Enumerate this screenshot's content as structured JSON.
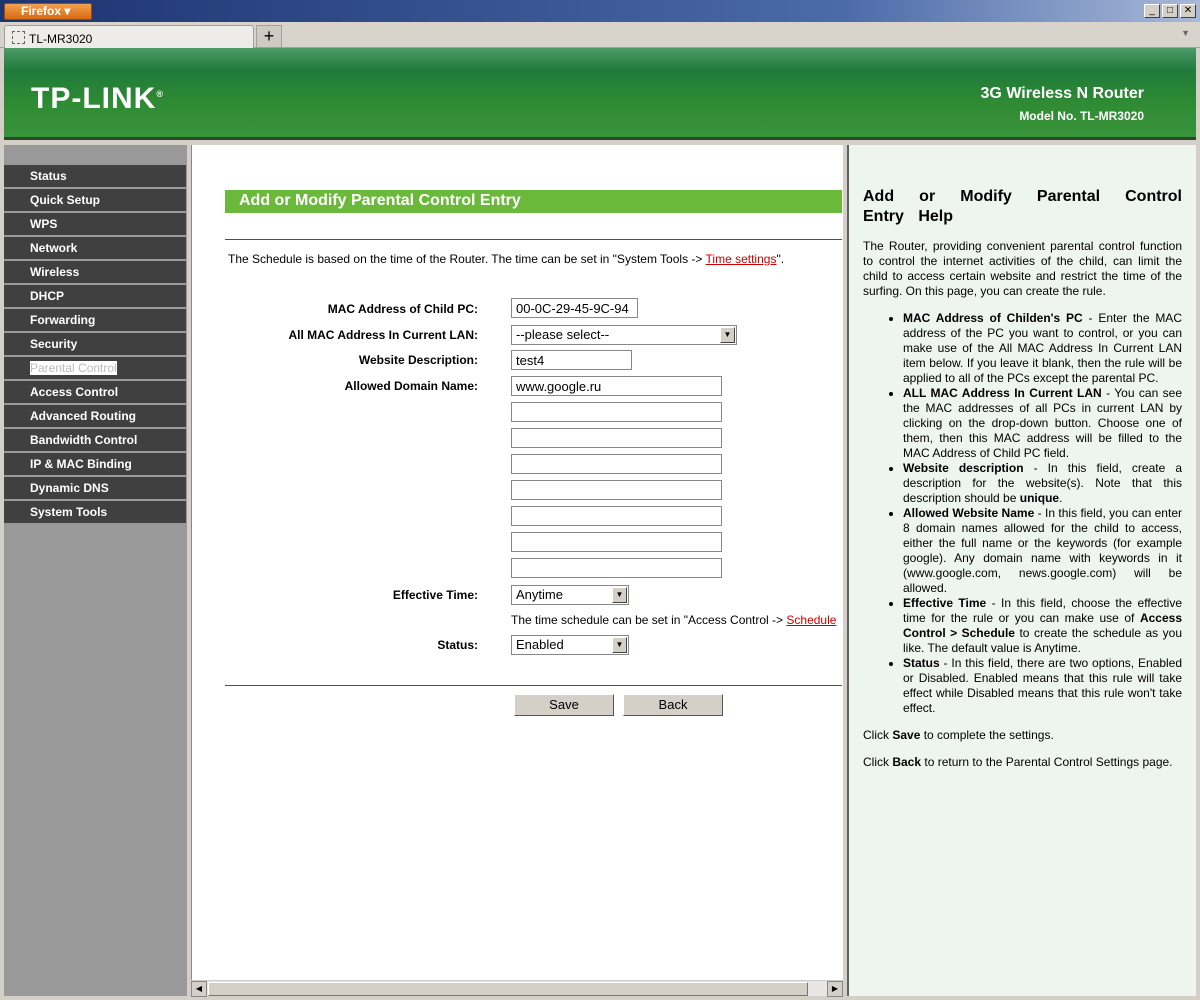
{
  "browser": {
    "menu_label": "Firefox",
    "tab_title": "TL-MR3020",
    "new_tab": "+",
    "window_controls": [
      "_",
      "□",
      "✕"
    ]
  },
  "banner": {
    "logo": "TP-LINK",
    "product": "3G Wireless N Router",
    "model": "Model No. TL-MR3020",
    "brand_color": "#2e8a34"
  },
  "sidebar": {
    "active": "Parental Control",
    "items": [
      "Status",
      "Quick Setup",
      "WPS",
      "Network",
      "Wireless",
      "DHCP",
      "Forwarding",
      "Security",
      "Parental Control",
      "Access Control",
      "Advanced Routing",
      "Bandwidth Control",
      "IP & MAC Binding",
      "Dynamic DNS",
      "System Tools"
    ]
  },
  "main": {
    "title": "Add or Modify Parental Control Entry",
    "note_prefix": "The Schedule is based on the time of the Router. The time can be set in \"System Tools -> ",
    "note_link": "Time settings",
    "note_suffix": "\".",
    "labels": {
      "mac": "MAC Address of Child PC:",
      "all_mac": "All MAC Address In Current LAN:",
      "desc": "Website Description:",
      "domain": "Allowed Domain Name:",
      "time": "Effective Time:",
      "status": "Status:"
    },
    "mac_value": "00-0C-29-45-9C-94",
    "all_mac_selected": "--please select--",
    "desc_value": "test4",
    "domains": [
      "www.google.ru",
      "",
      "",
      "",
      "",
      "",
      "",
      ""
    ],
    "time_selected": "Anytime",
    "schedule_note": "The time schedule can be set in \"Access Control -> ",
    "schedule_link": "Schedule",
    "status_selected": "Enabled",
    "save": "Save",
    "back": "Back"
  },
  "help": {
    "title": "Add or Modify Parental Control Entry Help",
    "intro": "The Router, providing convenient parental control function to control the internet activities of the child, can limit the child to access certain website and restrict the time of the surfing. On this page, you can create the rule.",
    "items": [
      {
        "term": "MAC Address of Childen's PC",
        "text": " - Enter the MAC address of the PC you want to control, or you can make use of the All MAC Address In Current LAN item below. If you leave it blank, then the rule will be applied to all of the PCs except the parental PC."
      },
      {
        "term": "ALL MAC Address In Current LAN",
        "text": " - You can see the MAC addresses of all PCs in current LAN by clicking on the drop-down button. Choose one of them, then this MAC address will be filled to the MAC Address of Child PC field."
      },
      {
        "term": "Website description",
        "text": " - In this field, create a description for the website(s). Note that this description should be ",
        "bold2": "unique",
        "tail": "."
      },
      {
        "term": "Allowed Website Name",
        "text": " - In this field, you can enter 8 domain names allowed for the child to access, either the full name or the keywords (for example google). Any domain name with keywords in it (www.google.com, news.google.com) will be allowed."
      },
      {
        "term": "Effective Time",
        "text": " - In this field, choose the effective time for the rule or you can make use of ",
        "bold2": "Access Control > Schedule",
        "tail": " to create the schedule as you like. The default value is Anytime."
      },
      {
        "term": "Status",
        "text": " - In this field, there are two options, Enabled or Disabled. Enabled means that this rule will take effect while Disabled means that this rule won't take effect."
      }
    ],
    "save_pre": "Click ",
    "save_b": "Save",
    "save_post": " to complete the settings.",
    "back_pre": "Click ",
    "back_b": "Back",
    "back_post": " to return to the Parental Control Settings page."
  }
}
